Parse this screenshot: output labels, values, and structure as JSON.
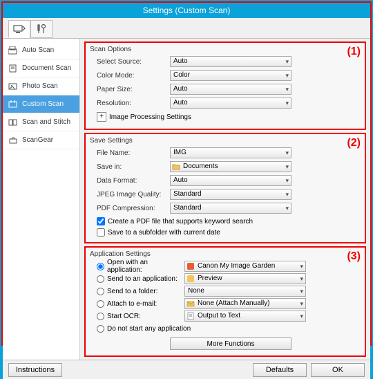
{
  "window": {
    "title": "Settings (Custom Scan)"
  },
  "sidebar": {
    "items": [
      {
        "label": "Auto Scan"
      },
      {
        "label": "Document Scan"
      },
      {
        "label": "Photo Scan"
      },
      {
        "label": "Custom Scan"
      },
      {
        "label": "Scan and Stitch"
      },
      {
        "label": "ScanGear"
      }
    ]
  },
  "groups": {
    "scan": {
      "title": "Scan Options",
      "callout": "(1)",
      "select_source_label": "Select Source:",
      "select_source_value": "Auto",
      "color_mode_label": "Color Mode:",
      "color_mode_value": "Color",
      "paper_size_label": "Paper Size:",
      "paper_size_value": "Auto",
      "resolution_label": "Resolution:",
      "resolution_value": "Auto",
      "image_proc_label": "Image Processing Settings",
      "expander": "+"
    },
    "save": {
      "title": "Save Settings",
      "callout": "(2)",
      "file_name_label": "File Name:",
      "file_name_value": "IMG",
      "save_in_label": "Save in:",
      "save_in_value": "Documents",
      "data_format_label": "Data Format:",
      "data_format_value": "Auto",
      "jpeg_quality_label": "JPEG Image Quality:",
      "jpeg_quality_value": "Standard",
      "pdf_comp_label": "PDF Compression:",
      "pdf_comp_value": "Standard",
      "chk_keyword": "Create a PDF file that supports keyword search",
      "chk_subfolder": "Save to a subfolder with current date"
    },
    "app": {
      "title": "Application Settings",
      "callout": "(3)",
      "open_with_label": "Open with an application:",
      "open_with_value": "Canon My Image Garden",
      "send_app_label": "Send to an application:",
      "send_app_value": "Preview",
      "send_folder_label": "Send to a folder:",
      "send_folder_value": "None",
      "attach_label": "Attach to e-mail:",
      "attach_value": "None (Attach Manually)",
      "ocr_label": "Start OCR:",
      "ocr_value": "Output to Text",
      "nostart_label": "Do not start any application",
      "more_functions": "More Functions"
    }
  },
  "footer": {
    "instructions": "Instructions",
    "defaults": "Defaults",
    "ok": "OK"
  }
}
